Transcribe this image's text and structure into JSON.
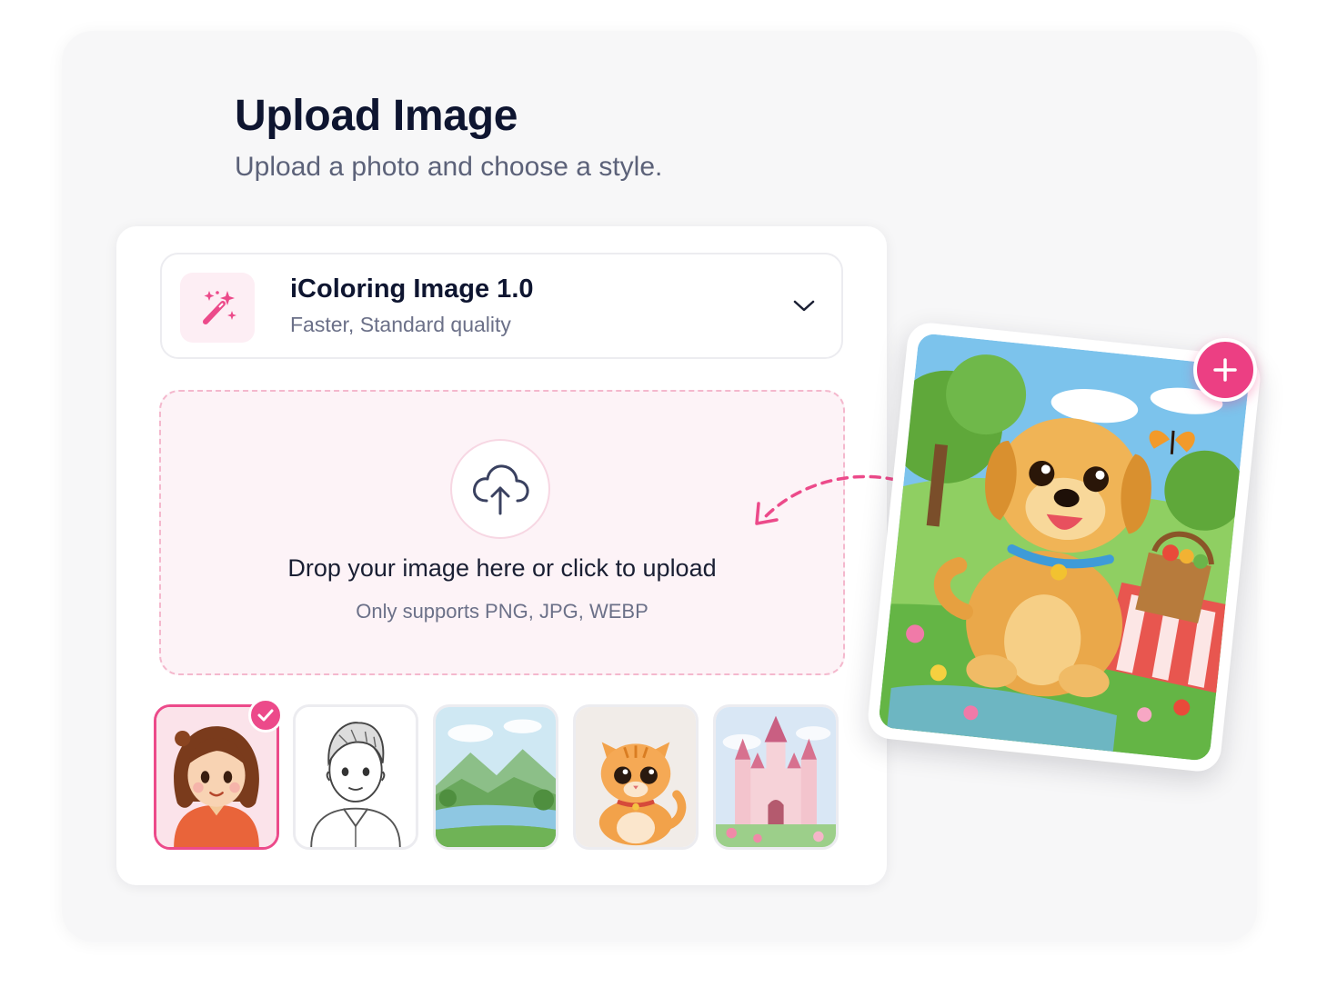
{
  "header": {
    "title": "Upload Image",
    "subtitle": "Upload a photo and choose a style."
  },
  "model_selector": {
    "icon": "magic-wand-icon",
    "name": "iColoring Image 1.0",
    "description": "Faster, Standard quality",
    "chevron_icon": "chevron-down-icon"
  },
  "upload": {
    "icon": "cloud-upload-icon",
    "prompt": "Drop your image here or click to upload",
    "formats": "Only supports PNG, JPG, WEBP"
  },
  "style_thumbnails": [
    {
      "id": "cartoon-girl",
      "selected": true
    },
    {
      "id": "line-art-boy",
      "selected": false
    },
    {
      "id": "landscape",
      "selected": false
    },
    {
      "id": "kitten",
      "selected": false
    },
    {
      "id": "castle",
      "selected": false
    }
  ],
  "preview": {
    "image": "puppy-picnic",
    "add_icon": "plus-icon"
  },
  "colors": {
    "accent": "#ec4a8a",
    "dropzone_bg": "#fdf3f7",
    "title": "#0e1530",
    "muted": "#6b7088"
  }
}
